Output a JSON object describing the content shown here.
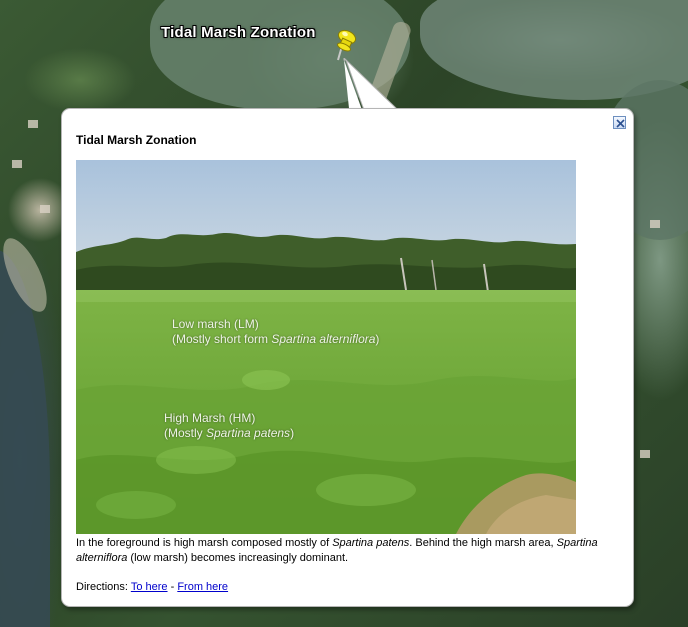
{
  "map": {
    "placemark_label": "Tidal Marsh Zonation",
    "pin_icon": "yellow-pushpin-icon"
  },
  "balloon": {
    "title": "Tidal Marsh Zonation",
    "close_icon": "close-icon",
    "photo": {
      "low_marsh_line1": "Low marsh (LM)",
      "low_marsh_line2_prefix": "(Mostly short form ",
      "low_marsh_line2_species": "Spartina alterniflora",
      "low_marsh_line2_suffix": ")",
      "high_marsh_line1": "High Marsh (HM)",
      "high_marsh_line2_prefix": "(Mostly ",
      "high_marsh_line2_species": "Spartina patens",
      "high_marsh_line2_suffix": ")"
    },
    "caption": {
      "part1": "In the foreground is high marsh composed mostly of ",
      "species1": "Spartina patens",
      "part2": ". Behind the high marsh area, ",
      "species2": "Spartina alterniflora",
      "part3": " (low marsh) becomes increasingly dominant."
    },
    "directions": {
      "label": "Directions: ",
      "to_here": "To here",
      "separator": " - ",
      "from_here": "From here"
    }
  },
  "colors": {
    "link": "#0000cc",
    "pin": "#f2e51c",
    "balloon_border": "#b5b5b5"
  }
}
